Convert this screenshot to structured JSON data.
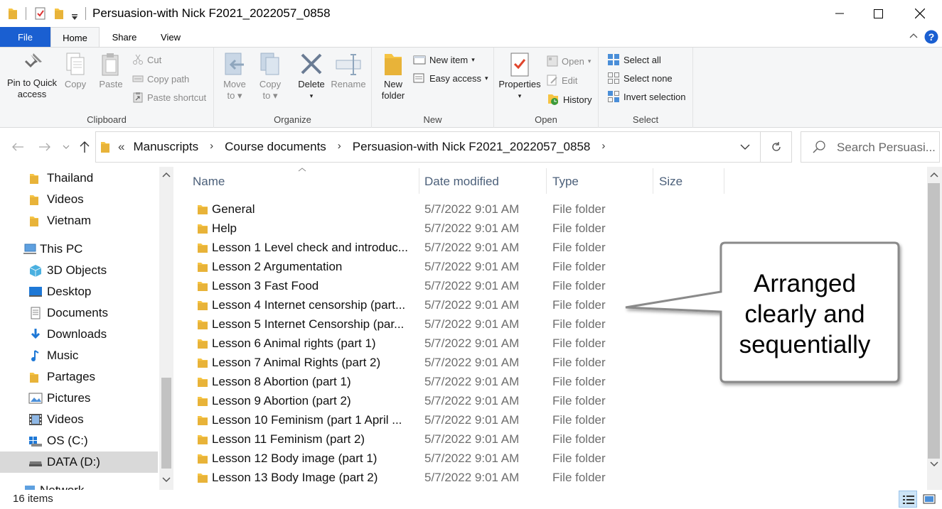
{
  "window": {
    "title": "Persuasion-with Nick F2021_2022057_0858"
  },
  "ribbon_tabs": [
    "File",
    "Home",
    "Share",
    "View"
  ],
  "ribbon": {
    "clipboard": {
      "label": "Clipboard",
      "pin_label_1": "Pin to Quick",
      "pin_label_2": "access",
      "copy": "Copy",
      "paste": "Paste",
      "cut": "Cut",
      "copy_path": "Copy path",
      "paste_shortcut": "Paste shortcut"
    },
    "organize": {
      "label": "Organize",
      "move_to_1": "Move",
      "move_to_2": "to",
      "copy_to_1": "Copy",
      "copy_to_2": "to",
      "delete": "Delete",
      "rename": "Rename"
    },
    "new": {
      "label": "New",
      "new_folder_1": "New",
      "new_folder_2": "folder",
      "new_item": "New item",
      "easy_access": "Easy access"
    },
    "open": {
      "label": "Open",
      "properties": "Properties",
      "open": "Open",
      "edit": "Edit",
      "history": "History"
    },
    "select": {
      "label": "Select",
      "select_all": "Select all",
      "select_none": "Select none",
      "invert_selection": "Invert selection"
    }
  },
  "address": {
    "overflow": "«",
    "crumbs": [
      "Manuscripts",
      "Course documents",
      "Persuasion-with Nick F2021_2022057_0858"
    ],
    "search_placeholder": "Search Persuasi..."
  },
  "nav_pane": [
    {
      "label": "Thailand",
      "icon": "folder-icon"
    },
    {
      "label": "Videos",
      "icon": "folder-icon"
    },
    {
      "label": "Vietnam",
      "icon": "folder-icon"
    },
    {
      "label": "This PC",
      "icon": "pc-icon"
    },
    {
      "label": "3D Objects",
      "icon": "3d-objects-icon"
    },
    {
      "label": "Desktop",
      "icon": "desktop-icon"
    },
    {
      "label": "Documents",
      "icon": "documents-icon"
    },
    {
      "label": "Downloads",
      "icon": "downloads-icon"
    },
    {
      "label": "Music",
      "icon": "music-icon"
    },
    {
      "label": "Partages",
      "icon": "folder-icon"
    },
    {
      "label": "Pictures",
      "icon": "pictures-icon"
    },
    {
      "label": "Videos",
      "icon": "videos-icon"
    },
    {
      "label": "OS (C:)",
      "icon": "drive-c-icon"
    },
    {
      "label": "DATA (D:)",
      "icon": "drive-d-icon"
    },
    {
      "label": "Network",
      "icon": "network-icon"
    }
  ],
  "columns": {
    "name": "Name",
    "date": "Date modified",
    "type": "Type",
    "size": "Size"
  },
  "files": [
    {
      "name": "General",
      "date": "5/7/2022 9:01 AM",
      "type": "File folder"
    },
    {
      "name": "Help",
      "date": "5/7/2022 9:01 AM",
      "type": "File folder"
    },
    {
      "name": "Lesson 1 Level check and introduc...",
      "date": "5/7/2022 9:01 AM",
      "type": "File folder"
    },
    {
      "name": "Lesson 2 Argumentation",
      "date": "5/7/2022 9:01 AM",
      "type": "File folder"
    },
    {
      "name": "Lesson 3 Fast Food",
      "date": "5/7/2022 9:01 AM",
      "type": "File folder"
    },
    {
      "name": "Lesson 4 Internet censorship (part...",
      "date": "5/7/2022 9:01 AM",
      "type": "File folder"
    },
    {
      "name": "Lesson 5 Internet Censorship (par...",
      "date": "5/7/2022 9:01 AM",
      "type": "File folder"
    },
    {
      "name": "Lesson 6 Animal rights (part 1)",
      "date": "5/7/2022 9:01 AM",
      "type": "File folder"
    },
    {
      "name": "Lesson 7 Animal Rights (part 2)",
      "date": "5/7/2022 9:01 AM",
      "type": "File folder"
    },
    {
      "name": "Lesson 8 Abortion (part 1)",
      "date": "5/7/2022 9:01 AM",
      "type": "File folder"
    },
    {
      "name": "Lesson 9 Abortion (part 2)",
      "date": "5/7/2022 9:01 AM",
      "type": "File folder"
    },
    {
      "name": "Lesson 10 Feminism (part 1 April ...",
      "date": "5/7/2022 9:01 AM",
      "type": "File folder"
    },
    {
      "name": "Lesson 11 Feminism (part 2)",
      "date": "5/7/2022 9:01 AM",
      "type": "File folder"
    },
    {
      "name": "Lesson 12 Body image (part 1)",
      "date": "5/7/2022 9:01 AM",
      "type": "File folder"
    },
    {
      "name": "Lesson 13 Body Image (part 2)",
      "date": "5/7/2022 9:01 AM",
      "type": "File folder"
    }
  ],
  "callout": {
    "line1": "Arranged",
    "line2": "clearly and",
    "line3": "sequentially"
  },
  "status": {
    "item_count": "16 items"
  },
  "colors": {
    "file_tab": "#1a5fd1",
    "folder": "#f6c444",
    "header_text": "#4c607a",
    "selected_nav": "#d9d9d9"
  }
}
